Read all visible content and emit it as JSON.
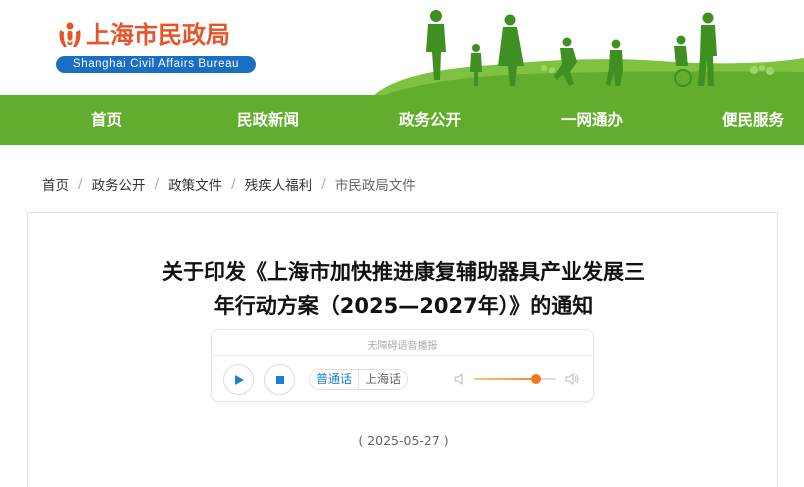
{
  "header": {
    "title_cn": "上海市民政局",
    "title_en": "Shanghai Civil Affairs Bureau",
    "logo_icon": "civil-affairs-emblem-icon"
  },
  "nav": {
    "items": [
      {
        "label": "首页"
      },
      {
        "label": "民政新闻"
      },
      {
        "label": "政务公开"
      },
      {
        "label": "一网通办"
      },
      {
        "label": "便民服务"
      }
    ]
  },
  "breadcrumb": {
    "items": [
      "首页",
      "政务公开",
      "政策文件",
      "残疾人福利",
      "市民政局文件"
    ],
    "separator": "/"
  },
  "article": {
    "title_line1": "关于印发《上海市加快推进康复辅助器具产业发展三",
    "title_line2": "年行动方案（2025—2027年）》的通知",
    "date": "( 2025-05-27 )"
  },
  "player": {
    "label": "无障碍语音播报",
    "lang_mandarin": "普通话",
    "lang_shanghainese": "上海话",
    "volume_level": 0.75
  },
  "colors": {
    "nav_green": "#63ad2e",
    "logo_orange": "#e8542a",
    "logo_blue": "#1a6fc4",
    "accent_orange": "#f07a1e"
  }
}
